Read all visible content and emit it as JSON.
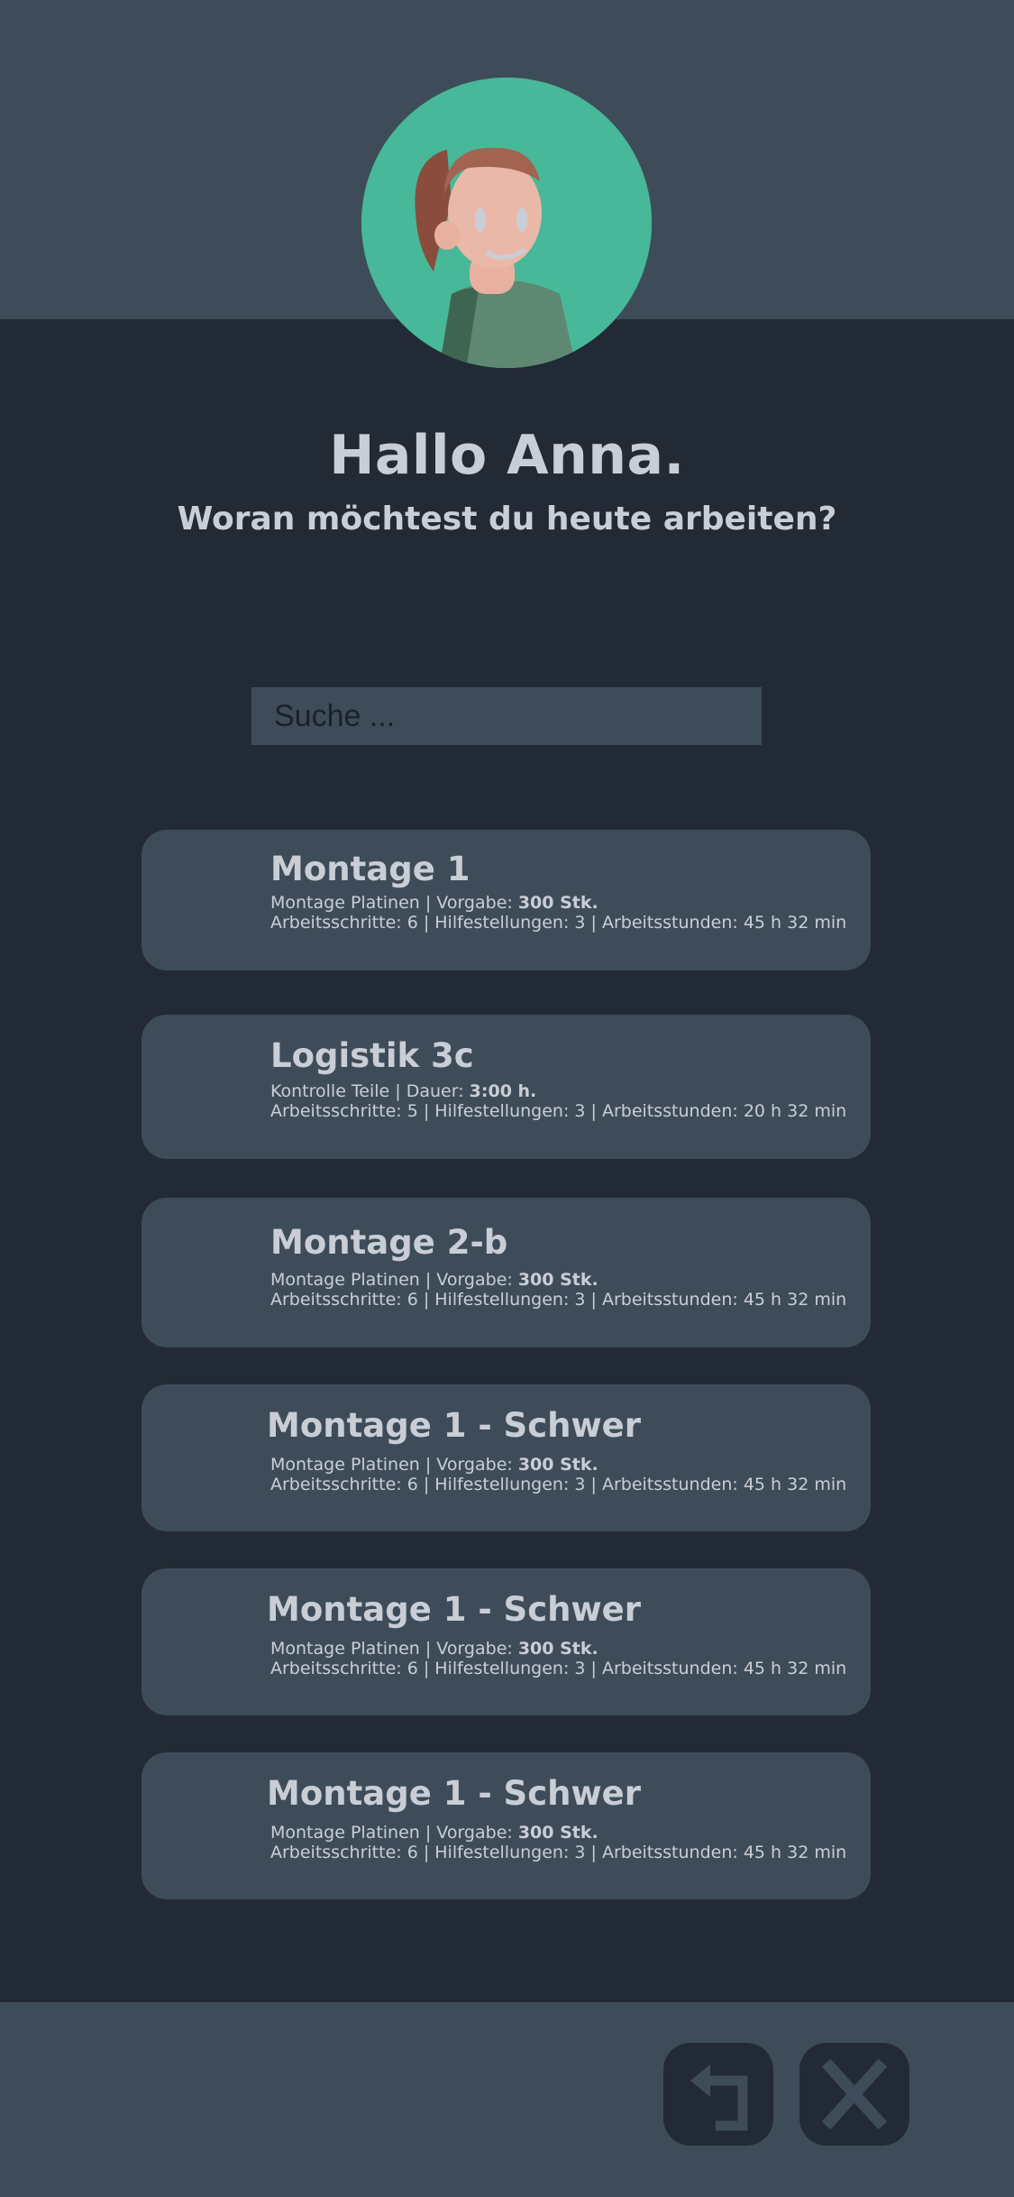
{
  "header": {
    "greeting": "Hallo Anna.",
    "question": "Woran möchtest du heute arbeiten?"
  },
  "search": {
    "placeholder": "Suche ..."
  },
  "tasks": [
    {
      "title": "Montage 1",
      "type_label": "Montage Platinen | Vorgabe: ",
      "type_value": "300 Stk.",
      "stats": "Arbeitsschritte: 6 | Hilfestellungen: 3 | Arbeitsstunden: 45 h 32 min"
    },
    {
      "title": "Logistik 3c",
      "type_label": "Kontrolle Teile | Dauer: ",
      "type_value": "3:00 h.",
      "stats": "Arbeitsschritte: 5 | Hilfestellungen: 3 | Arbeitsstunden: 20 h 32 min"
    },
    {
      "title": "Montage 2-b",
      "type_label": "Montage Platinen | Vorgabe: ",
      "type_value": "300 Stk.",
      "stats": "Arbeitsschritte: 6 | Hilfestellungen: 3 | Arbeitsstunden: 45 h 32 min"
    },
    {
      "title": "Montage 1 - Schwer",
      "type_label": "Montage Platinen | Vorgabe: ",
      "type_value": "300 Stk.",
      "stats": "Arbeitsschritte: 6 | Hilfestellungen: 3 | Arbeitsstunden: 45 h 32 min"
    },
    {
      "title": "Montage 1 - Schwer",
      "type_label": "Montage Platinen | Vorgabe: ",
      "type_value": "300 Stk.",
      "stats": "Arbeitsschritte: 6 | Hilfestellungen: 3 | Arbeitsstunden: 45 h 32 min"
    },
    {
      "title": "Montage 1 - Schwer",
      "type_label": "Montage Platinen | Vorgabe: ",
      "type_value": "300 Stk.",
      "stats": "Arbeitsschritte: 6 | Hilfestellungen: 3 | Arbeitsstunden: 45 h 32 min"
    }
  ],
  "footer": {
    "back_icon": "return-arrow-icon",
    "close_icon": "close-x-icon"
  },
  "colors": {
    "background": "#222a35",
    "panel": "#3e4c5a",
    "accent": "#47b898",
    "text": "#c9ced6"
  }
}
